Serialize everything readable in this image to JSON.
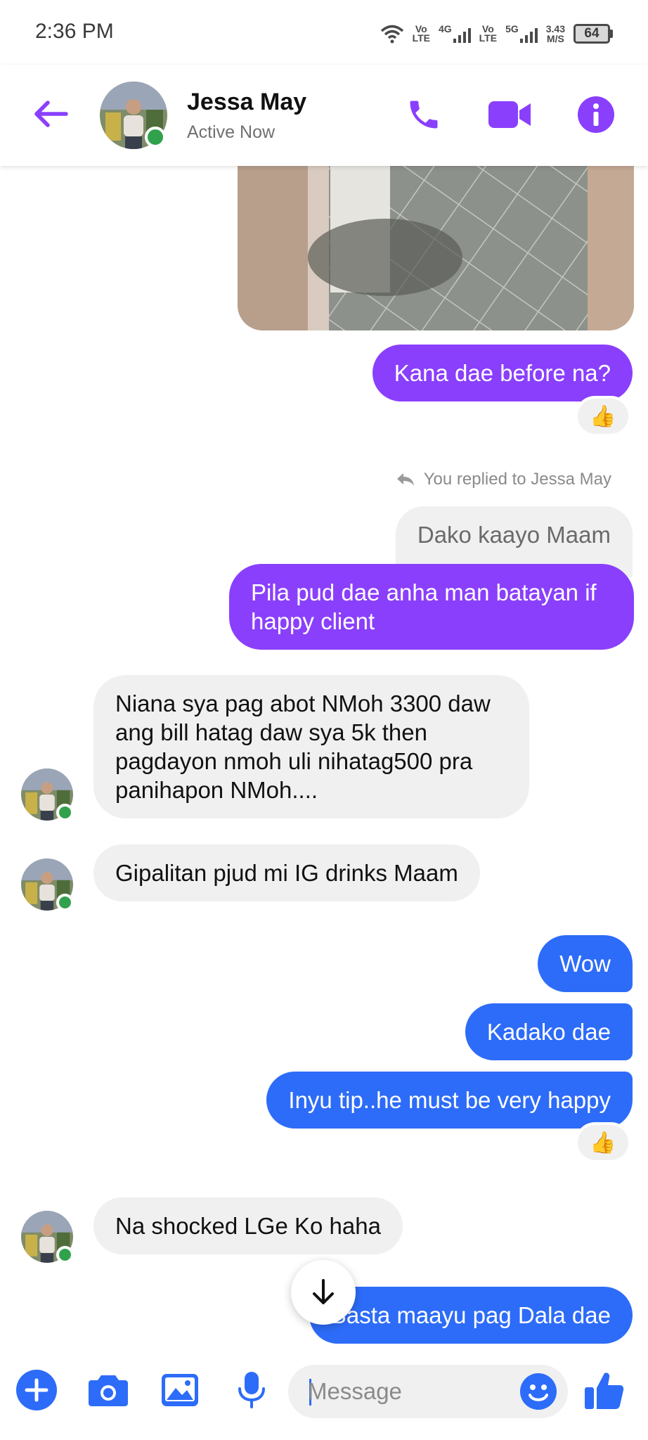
{
  "status_bar": {
    "time": "2:36 PM",
    "sim1_label_top": "Vo",
    "sim1_label_bottom": "LTE",
    "sim1_network": "4G",
    "sim2_label_top": "Vo",
    "sim2_label_bottom": "LTE",
    "sim2_network": "5G",
    "speed_value": "3.43",
    "speed_unit": "M/S",
    "battery": "64"
  },
  "header": {
    "contact_name": "Jessa May",
    "contact_status": "Active Now"
  },
  "colors": {
    "accent_purple": "#8a3ffc",
    "bubble_blue": "#2d6cf8",
    "incoming_bubble": "#f0f0f0",
    "online_green": "#31a24c"
  },
  "messages": [
    {
      "from": "me",
      "text": "Kana dae before na?",
      "reaction": "👍"
    },
    {
      "from": "me",
      "type": "reply_label",
      "text": "You replied to Jessa May"
    },
    {
      "from": "them",
      "type": "quoted",
      "text": "Dako kaayo Maam"
    },
    {
      "from": "me",
      "text_lines": [
        "Pila pud dae anha man batayan if",
        "happy client"
      ]
    },
    {
      "from": "them",
      "text_lines": [
        "Niana sya pag abot NMoh 3300 daw",
        "ang bill hatag daw sya 5k then",
        "pagdayon nmoh uli nihatag500 pra",
        "panihapon NMoh...."
      ]
    },
    {
      "from": "them",
      "text": "Gipalitan pjud mi IG drinks Maam"
    },
    {
      "from": "me",
      "text": "Wow"
    },
    {
      "from": "me",
      "text": "Kadako dae"
    },
    {
      "from": "me",
      "text": "Inyu tip..he must be very happy",
      "reaction": "👍"
    },
    {
      "from": "them",
      "text": "Na shocked LGe Ko haha"
    },
    {
      "from": "me",
      "text": "Basta maayu pag Dala dae"
    }
  ],
  "composer": {
    "placeholder": "Message"
  },
  "icons": {
    "back": "arrow-left-icon",
    "call": "phone-icon",
    "video": "video-camera-icon",
    "info": "info-icon",
    "more": "plus-icon",
    "camera": "camera-icon",
    "gallery": "image-icon",
    "voice": "microphone-icon",
    "emoji": "smiley-icon",
    "like": "thumbs-up-icon",
    "scroll": "arrow-down-icon"
  }
}
